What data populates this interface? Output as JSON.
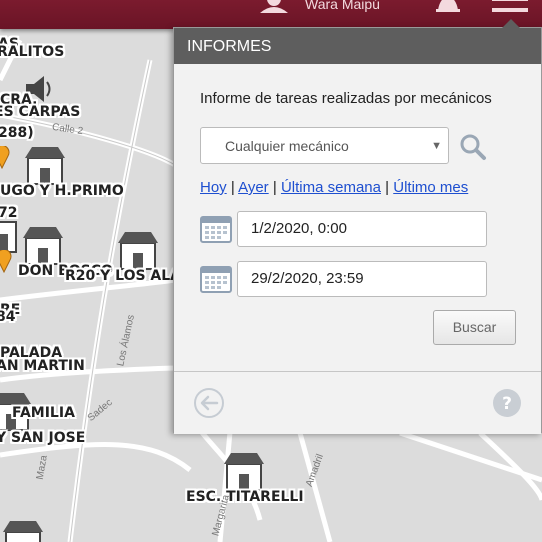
{
  "topbar": {
    "user_label": "Wara Maipú",
    "icons": [
      "user-icon",
      "bell-icon",
      "menu-icon"
    ]
  },
  "map": {
    "pois": [
      {
        "label": "AS"
      },
      {
        "label": "RALITOS"
      },
      {
        "label": "CRA."
      },
      {
        "label": "ES CARPAS"
      },
      {
        "label": "288)"
      },
      {
        "label": "UGO Y H.PRIMO"
      },
      {
        "label": "72"
      },
      {
        "label": "DON BOSCO"
      },
      {
        "label": "R20 Y LOS ALA"
      },
      {
        "label": "RE"
      },
      {
        "label": "84"
      },
      {
        "label": "PALADA"
      },
      {
        "label": "AN MARTIN"
      },
      {
        "label": "FAMILIA"
      },
      {
        "label": "Y SAN JOSE"
      },
      {
        "label": "ESC. TITARELLI"
      }
    ],
    "streets": [
      {
        "label": "Calle 2"
      },
      {
        "label": "Los Álamos"
      },
      {
        "label": "Sadec"
      },
      {
        "label": "Maza"
      },
      {
        "label": "Amadril"
      },
      {
        "label": "Margarita"
      }
    ]
  },
  "panel": {
    "header": "INFORMES",
    "subtitle": "Informe de tareas realizadas por mecánicos",
    "mechanic_select": "Cualquier mecánico",
    "links": {
      "today": "Hoy",
      "yesterday": "Ayer",
      "last_week": "Última semana",
      "last_month": "Último mes",
      "separator": "|"
    },
    "date_from": "1/2/2020, 0:00",
    "date_to": "29/2/2020, 23:59",
    "search_button": "Buscar"
  },
  "colors": {
    "topbar": "#6f1628",
    "panel_header": "#5e5e5e",
    "link": "#1e4fd0",
    "panel_bg": "#f2f2f2"
  }
}
